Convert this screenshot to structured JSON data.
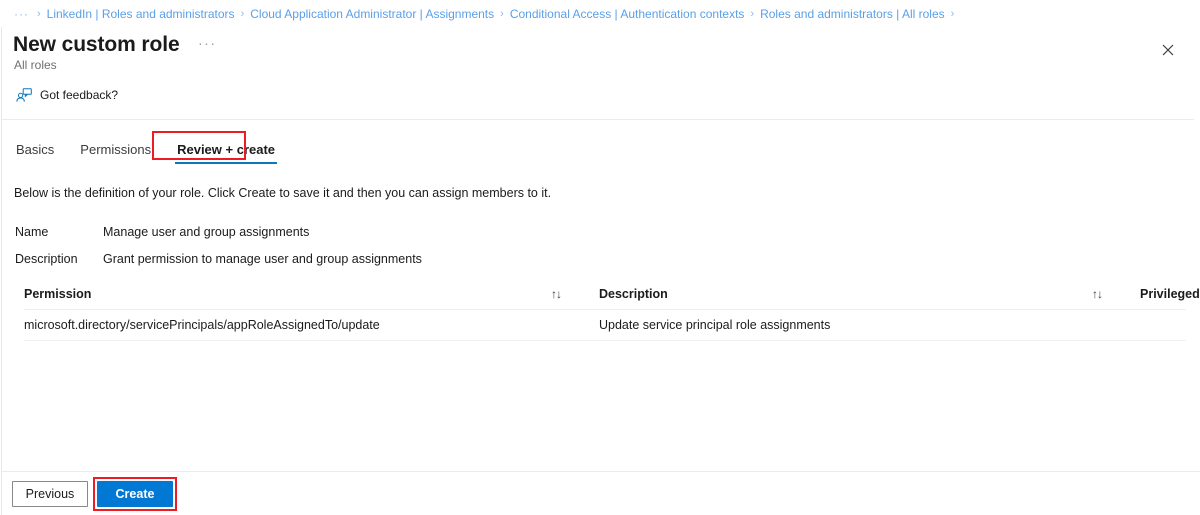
{
  "breadcrumb": {
    "overflow": "···",
    "separator": "›",
    "items": [
      "LinkedIn | Roles and administrators",
      "Cloud Application Administrator | Assignments",
      "Conditional Access | Authentication contexts",
      "Roles and administrators | All roles"
    ],
    "trailing_separator": "›"
  },
  "header": {
    "title": "New custom role",
    "more_label": "···",
    "subtitle": "All roles",
    "close_label": "✕"
  },
  "commandbar": {
    "feedback_label": "Got feedback?"
  },
  "tabs": [
    {
      "label": "Basics",
      "active": false
    },
    {
      "label": "Permissions",
      "active": false
    },
    {
      "label": "Review + create",
      "active": true
    }
  ],
  "main": {
    "intro": "Below is the definition of your role. Click Create to save it and then you can assign members to it.",
    "fields": [
      {
        "label": "Name",
        "value": "Manage user and group assignments"
      },
      {
        "label": "Description",
        "value": "Grant permission to manage user and group assignments"
      }
    ],
    "table": {
      "columns": {
        "permission": "Permission",
        "description": "Description",
        "privileged": "Privileged"
      },
      "sort_icon": "↑↓",
      "rows": [
        {
          "permission": "microsoft.directory/servicePrincipals/appRoleAssignedTo/update",
          "description": "Update service principal role assignments",
          "privileged": ""
        }
      ]
    }
  },
  "footer": {
    "previous_label": "Previous",
    "create_label": "Create"
  },
  "colors": {
    "accent": "#0078d4",
    "tab_underline": "#0f76bc",
    "breadcrumb_link": "#5aa0e8",
    "annotation": "#ed1c24",
    "text": "#1b1b1b",
    "muted": "#707070"
  }
}
